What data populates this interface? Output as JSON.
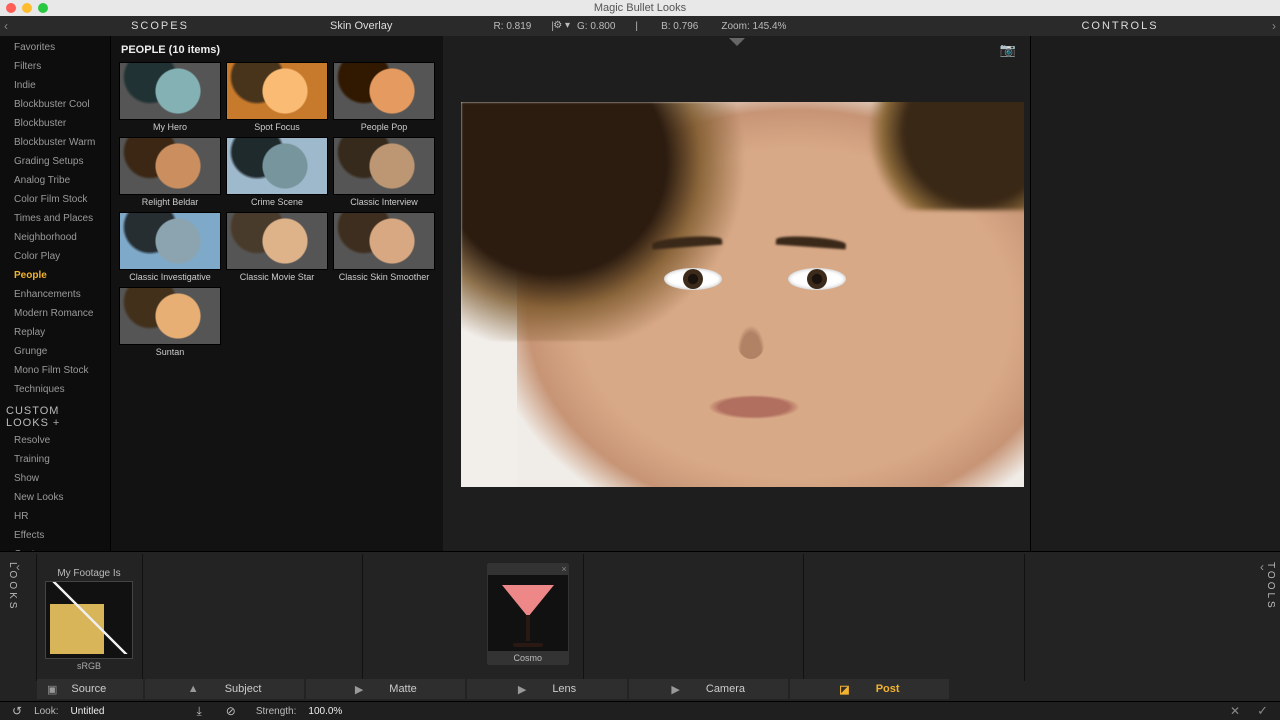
{
  "window": {
    "title": "Magic Bullet Looks"
  },
  "header": {
    "scopes": "SCOPES",
    "controls": "CONTROLS",
    "lookTitle": "Skin Overlay",
    "readout": {
      "r": "R: 0.819",
      "g": "G: 0.800",
      "b": "B: 0.796",
      "zoom": "Zoom: 145.4%"
    }
  },
  "categories": {
    "items": [
      "Favorites",
      "Filters",
      "Indie",
      "Blockbuster Cool",
      "Blockbuster",
      "Blockbuster Warm",
      "Grading Setups",
      "Analog Tribe",
      "Color Film Stock",
      "Times and Places",
      "Neighborhood",
      "Color Play",
      "People",
      "Enhancements",
      "Modern Romance",
      "Replay",
      "Grunge",
      "Mono Film Stock",
      "Techniques"
    ],
    "activeIndex": 12,
    "customHeader": "CUSTOM LOOKS",
    "customItems": [
      "Resolve",
      "Training",
      "Show",
      "New Looks",
      "HR",
      "Effects",
      "Custom"
    ]
  },
  "presets": {
    "title": "PEOPLE (10 items)",
    "items": [
      "My Hero",
      "Spot Focus",
      "People Pop",
      "Relight Beldar",
      "Crime Scene",
      "Classic Interview",
      "Classic Investigative",
      "Classic Movie Star",
      "Classic Skin Smoother",
      "Suntan"
    ]
  },
  "chain": {
    "looksTab": "LOOKS",
    "toolsTab": "TOOLS",
    "footage": {
      "title": "My Footage Is",
      "label": "sRGB"
    },
    "tool": {
      "name": "Cosmo"
    },
    "stages": {
      "source": "Source",
      "subject": "Subject",
      "matte": "Matte",
      "lens": "Lens",
      "camera": "Camera",
      "post": "Post"
    }
  },
  "footer": {
    "lookLabel": "Look:",
    "lookName": "Untitled",
    "strengthLabel": "Strength:",
    "strengthValue": "100.0%"
  }
}
